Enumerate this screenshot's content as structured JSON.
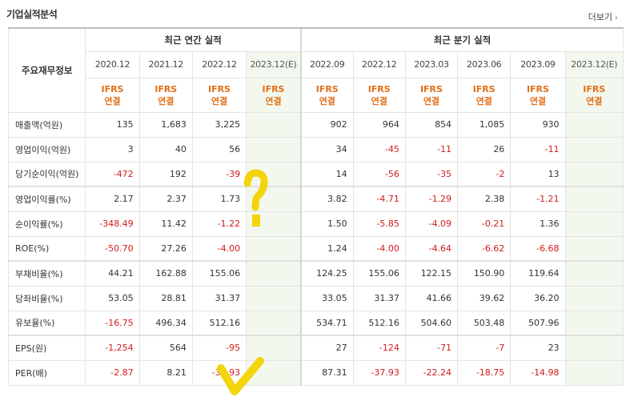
{
  "header": {
    "title": "기업실적분석",
    "more_label": "더보기"
  },
  "table": {
    "row_header": "주요재무정보",
    "groups": {
      "annual": "최근 연간 실적",
      "quarterly": "최근 분기 실적"
    },
    "annual_periods": [
      "2020.12",
      "2021.12",
      "2022.12",
      "2023.12(E)"
    ],
    "quarter_periods": [
      "2022.09",
      "2022.12",
      "2023.03",
      "2023.06",
      "2023.09",
      "2023.12(E)"
    ],
    "ifrs": {
      "line1": "IFRS",
      "line2": "연결"
    },
    "rows": [
      {
        "label": "매출액(억원)",
        "annual": [
          "135",
          "1,683",
          "3,225",
          ""
        ],
        "quarter": [
          "902",
          "964",
          "854",
          "1,085",
          "930",
          ""
        ]
      },
      {
        "label": "영업이익(억원)",
        "annual": [
          "3",
          "40",
          "56",
          ""
        ],
        "quarter": [
          "34",
          "-45",
          "-11",
          "26",
          "-11",
          ""
        ]
      },
      {
        "label": "당기순이익(억원)",
        "annual": [
          "-472",
          "192",
          "-39",
          ""
        ],
        "quarter": [
          "14",
          "-56",
          "-35",
          "-2",
          "13",
          ""
        ]
      },
      {
        "label": "영업이익률(%)",
        "annual": [
          "2.17",
          "2.37",
          "1.73",
          ""
        ],
        "quarter": [
          "3.82",
          "-4.71",
          "-1.29",
          "2.38",
          "-1.21",
          ""
        ]
      },
      {
        "label": "순이익률(%)",
        "annual": [
          "-348.49",
          "11.42",
          "-1.22",
          ""
        ],
        "quarter": [
          "1.50",
          "-5.85",
          "-4.09",
          "-0.21",
          "1.36",
          ""
        ]
      },
      {
        "label": "ROE(%)",
        "annual": [
          "-50.70",
          "27.26",
          "-4.00",
          ""
        ],
        "quarter": [
          "1.24",
          "-4.00",
          "-4.64",
          "-6.62",
          "-6.68",
          ""
        ]
      },
      {
        "label": "부채비율(%)",
        "annual": [
          "44.21",
          "162.88",
          "155.06",
          ""
        ],
        "quarter": [
          "124.25",
          "155.06",
          "122.15",
          "150.90",
          "119.64",
          ""
        ]
      },
      {
        "label": "당좌비율(%)",
        "annual": [
          "53.05",
          "28.81",
          "31.37",
          ""
        ],
        "quarter": [
          "33.05",
          "31.37",
          "41.66",
          "39.62",
          "36.20",
          ""
        ]
      },
      {
        "label": "유보율(%)",
        "annual": [
          "-16.75",
          "496.34",
          "512.16",
          ""
        ],
        "quarter": [
          "534.71",
          "512.16",
          "504.60",
          "503.48",
          "507.96",
          ""
        ]
      },
      {
        "label": "EPS(원)",
        "annual": [
          "-1,254",
          "564",
          "-95",
          ""
        ],
        "quarter": [
          "27",
          "-124",
          "-71",
          "-7",
          "23",
          ""
        ]
      },
      {
        "label": "PER(배)",
        "annual": [
          "-2.87",
          "8.21",
          "-37.93",
          ""
        ],
        "quarter": [
          "87.31",
          "-37.93",
          "-22.24",
          "-18.75",
          "-14.98",
          ""
        ]
      }
    ]
  },
  "annotations": {
    "color": "#f2d50a",
    "question_mark_icon": "question-mark-annotation",
    "check_icon": "checkmark-annotation"
  }
}
